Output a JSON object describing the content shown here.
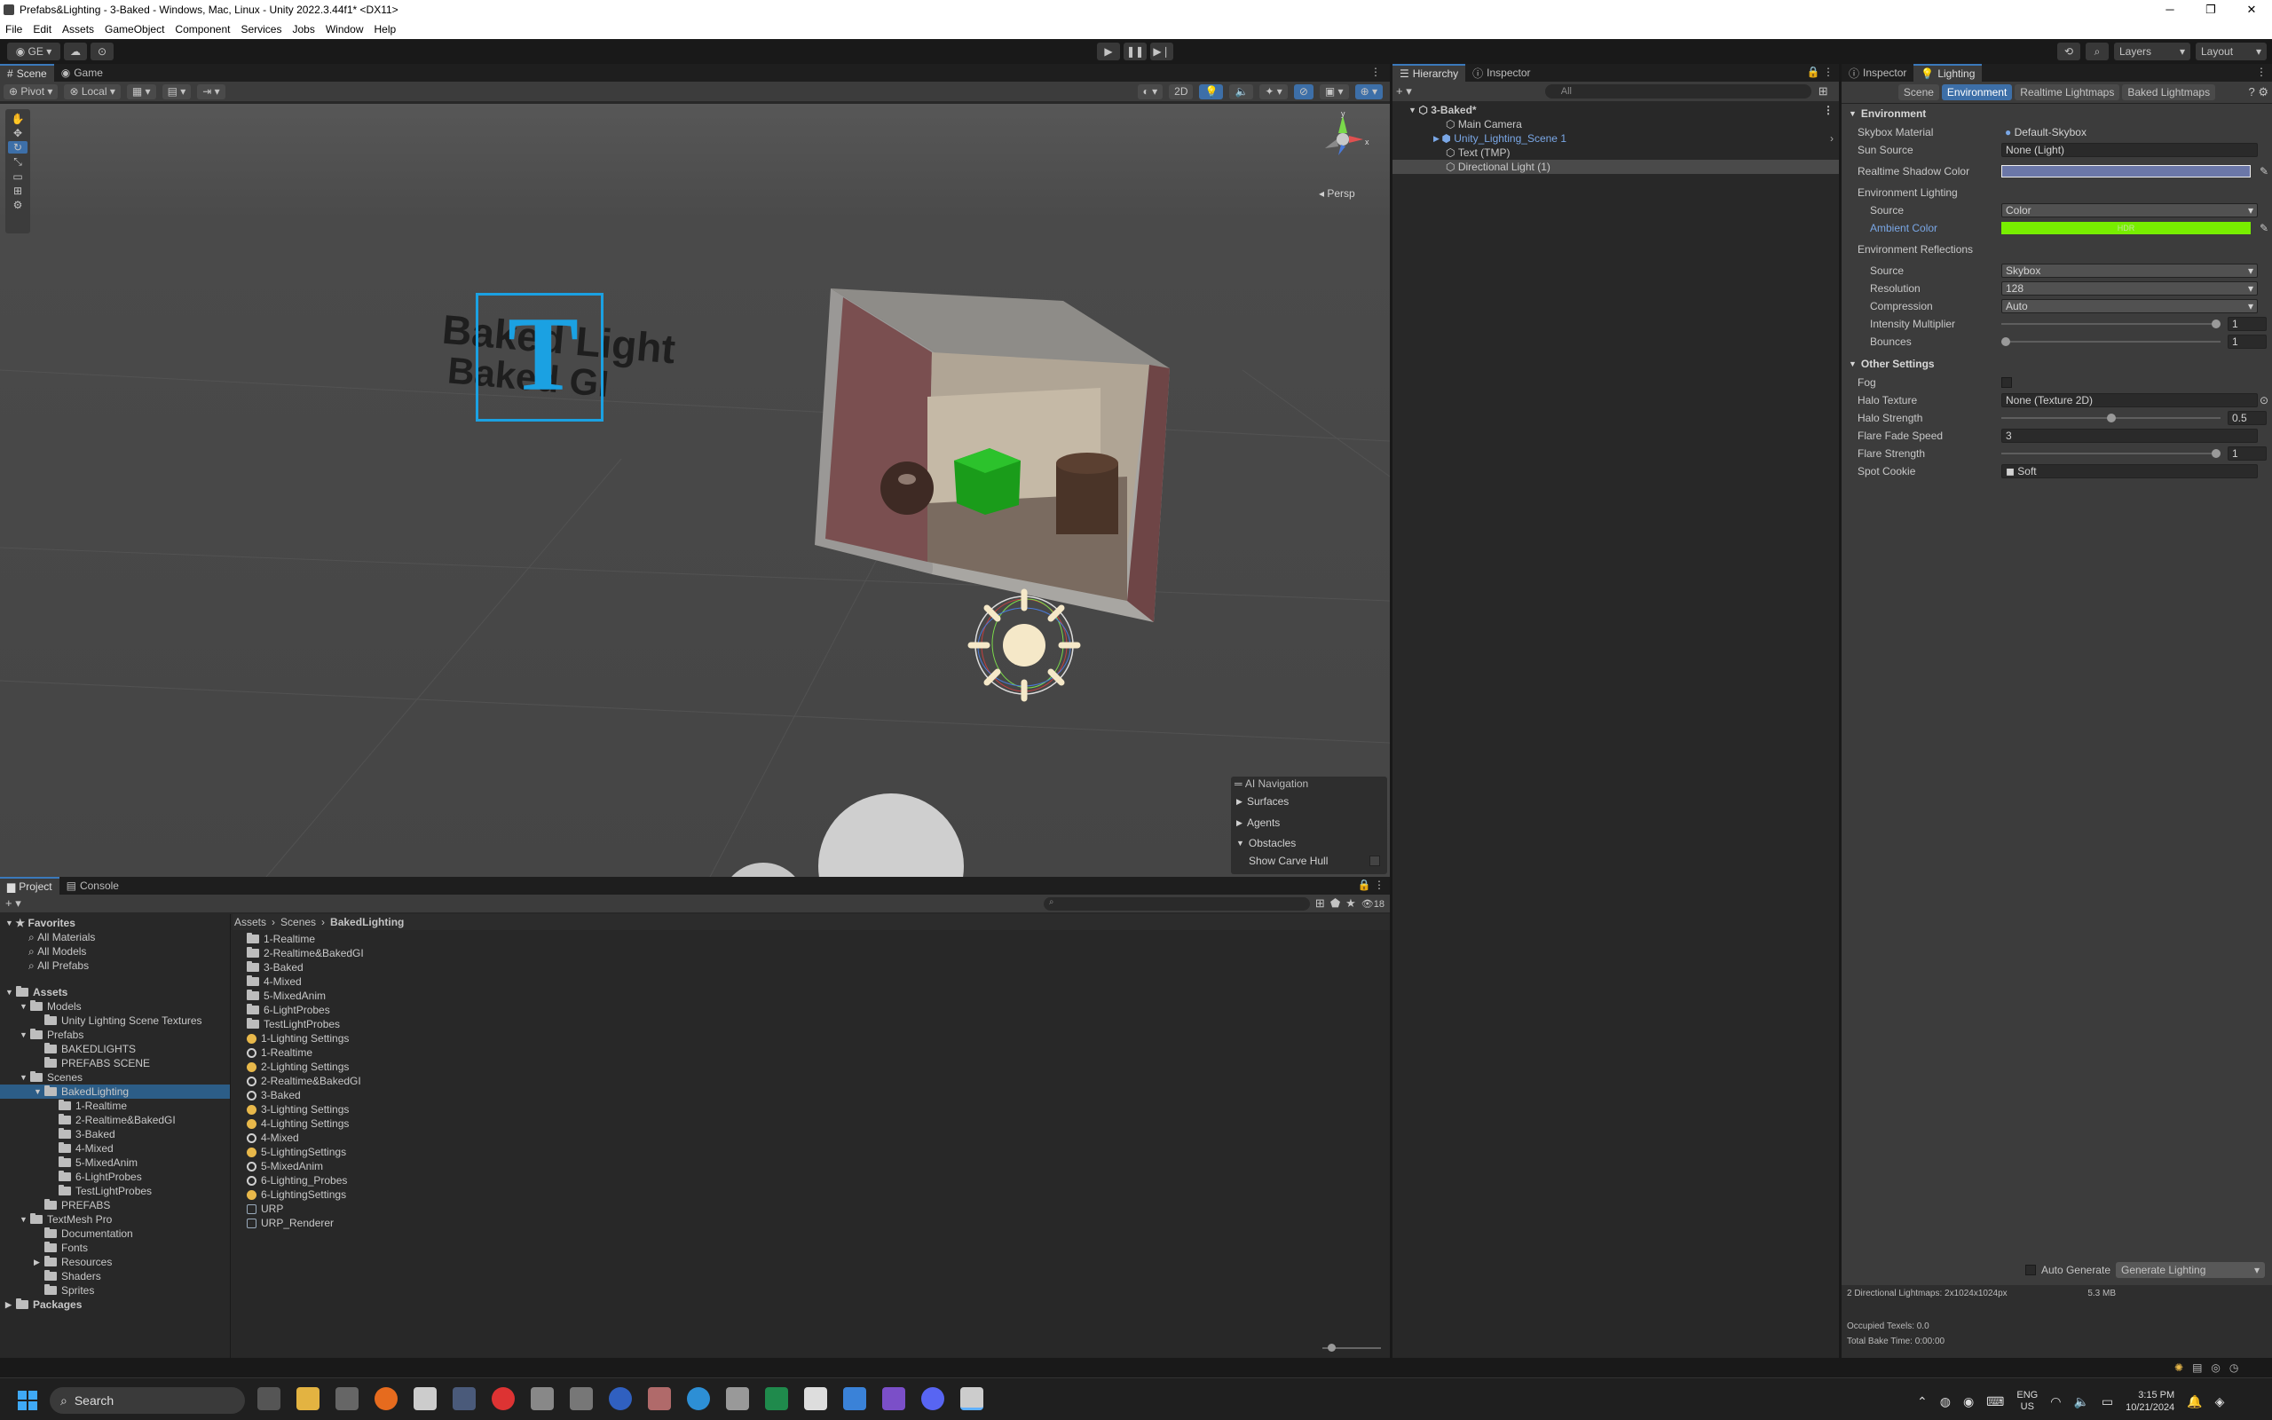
{
  "window": {
    "title": "Prefabs&Lighting - 3-Baked - Windows, Mac, Linux - Unity 2022.3.44f1* <DX11>",
    "controls": [
      "─",
      "❐",
      "✕"
    ]
  },
  "menu": [
    "File",
    "Edit",
    "Assets",
    "GameObject",
    "Component",
    "Services",
    "Jobs",
    "Window",
    "Help"
  ],
  "toolbar": {
    "account": "GE",
    "layers": "Layers",
    "layout": "Layout"
  },
  "scene_panel": {
    "tabs": [
      "Scene",
      "Game"
    ],
    "pivot": "Pivot",
    "local": "Local",
    "mode_2d": "2D",
    "persp": "Persp",
    "text_line1": "Baked Light",
    "text_line2": "Baked GI",
    "overlay": {
      "title": "AI Navigation",
      "items": [
        "Surfaces",
        "Agents",
        "Obstacles"
      ],
      "show_carve": "Show Carve Hull"
    }
  },
  "hierarchy": {
    "tabs": [
      "Hierarchy",
      "Inspector"
    ],
    "search_placeholder": "All",
    "scene": "3-Baked*",
    "items": [
      "Main Camera",
      "Unity_Lighting_Scene 1",
      "Text (TMP)",
      "Directional Light (1)"
    ]
  },
  "lighting": {
    "tabs": [
      "Inspector",
      "Lighting"
    ],
    "subtabs": [
      "Scene",
      "Environment",
      "Realtime Lightmaps",
      "Baked Lightmaps"
    ],
    "env_header": "Environment",
    "skybox_label": "Skybox Material",
    "skybox_value": "Default-Skybox",
    "sun_label": "Sun Source",
    "sun_value": "None (Light)",
    "shadow_label": "Realtime Shadow Color",
    "shadow_color": "#6b77a8",
    "env_lighting": "Environment Lighting",
    "source_label": "Source",
    "source_value": "Color",
    "ambient_label": "Ambient Color",
    "ambient_color": "#78ee00",
    "hdr": "HDR",
    "env_refl": "Environment Reflections",
    "refl_source_label": "Source",
    "refl_source_value": "Skybox",
    "resolution_label": "Resolution",
    "resolution_value": "128",
    "compression_label": "Compression",
    "compression_value": "Auto",
    "intensity_label": "Intensity Multiplier",
    "intensity_value": "1",
    "bounces_label": "Bounces",
    "bounces_value": "1",
    "other_header": "Other Settings",
    "fog_label": "Fog",
    "halo_tex_label": "Halo Texture",
    "halo_tex_value": "None (Texture 2D)",
    "halo_str_label": "Halo Strength",
    "halo_str_value": "0.5",
    "flare_fade_label": "Flare Fade Speed",
    "flare_fade_value": "3",
    "flare_str_label": "Flare Strength",
    "flare_str_value": "1",
    "spot_label": "Spot Cookie",
    "spot_value": "Soft",
    "auto_generate": "Auto Generate",
    "generate": "Generate Lighting",
    "lightmaps_info": "2 Directional Lightmaps: 2x1024x1024px",
    "lightmaps_size": "5.3 MB",
    "occupied": "Occupied Texels: 0.0",
    "bake_time": "Total Bake Time: 0:00:00"
  },
  "project": {
    "tabs": [
      "Project",
      "Console"
    ],
    "hidden_count": "18",
    "breadcrumb": [
      "Assets",
      "Scenes",
      "BakedLighting"
    ],
    "favorites": "Favorites",
    "fav_items": [
      "All Materials",
      "All Models",
      "All Prefabs"
    ],
    "tree": [
      {
        "label": "Assets",
        "lvl": 0,
        "bold": true
      },
      {
        "label": "Models",
        "lvl": 1
      },
      {
        "label": "Unity Lighting Scene Textures",
        "lvl": 2
      },
      {
        "label": "Prefabs",
        "lvl": 1
      },
      {
        "label": "BAKEDLIGHTS",
        "lvl": 2
      },
      {
        "label": "PREFABS SCENE",
        "lvl": 2
      },
      {
        "label": "Scenes",
        "lvl": 1
      },
      {
        "label": "BakedLighting",
        "lvl": 2,
        "sel": true
      },
      {
        "label": "1-Realtime",
        "lvl": 3
      },
      {
        "label": "2-Realtime&BakedGI",
        "lvl": 3
      },
      {
        "label": "3-Baked",
        "lvl": 3
      },
      {
        "label": "4-Mixed",
        "lvl": 3
      },
      {
        "label": "5-MixedAnim",
        "lvl": 3
      },
      {
        "label": "6-LightProbes",
        "lvl": 3
      },
      {
        "label": "TestLightProbes",
        "lvl": 3
      },
      {
        "label": "PREFABS",
        "lvl": 2
      },
      {
        "label": "TextMesh Pro",
        "lvl": 1
      },
      {
        "label": "Documentation",
        "lvl": 2
      },
      {
        "label": "Fonts",
        "lvl": 2
      },
      {
        "label": "Resources",
        "lvl": 2
      },
      {
        "label": "Shaders",
        "lvl": 2
      },
      {
        "label": "Sprites",
        "lvl": 2
      },
      {
        "label": "Packages",
        "lvl": 0,
        "bold": true
      }
    ],
    "files": [
      {
        "name": "1-Realtime",
        "kind": "folder"
      },
      {
        "name": "2-Realtime&BakedGI",
        "kind": "folder"
      },
      {
        "name": "3-Baked",
        "kind": "folder"
      },
      {
        "name": "4-Mixed",
        "kind": "folder"
      },
      {
        "name": "5-MixedAnim",
        "kind": "folder"
      },
      {
        "name": "6-LightProbes",
        "kind": "folder"
      },
      {
        "name": "TestLightProbes",
        "kind": "folder"
      },
      {
        "name": "1-Lighting Settings",
        "kind": "settings"
      },
      {
        "name": "1-Realtime",
        "kind": "scene"
      },
      {
        "name": "2-Lighting Settings",
        "kind": "settings"
      },
      {
        "name": "2-Realtime&BakedGI",
        "kind": "scene"
      },
      {
        "name": "3-Baked",
        "kind": "scene"
      },
      {
        "name": "3-Lighting Settings",
        "kind": "settings"
      },
      {
        "name": "4-Lighting Settings",
        "kind": "settings"
      },
      {
        "name": "4-Mixed",
        "kind": "scene"
      },
      {
        "name": "5-LightingSettings",
        "kind": "settings"
      },
      {
        "name": "5-MixedAnim",
        "kind": "scene"
      },
      {
        "name": "6-Lighting_Probes",
        "kind": "scene"
      },
      {
        "name": "6-LightingSettings",
        "kind": "settings"
      },
      {
        "name": "URP",
        "kind": "urp"
      },
      {
        "name": "URP_Renderer",
        "kind": "urp"
      }
    ]
  },
  "taskbar": {
    "search": "Search",
    "lang1": "ENG",
    "lang2": "US",
    "time": "3:15 PM",
    "date": "10/21/2024"
  }
}
